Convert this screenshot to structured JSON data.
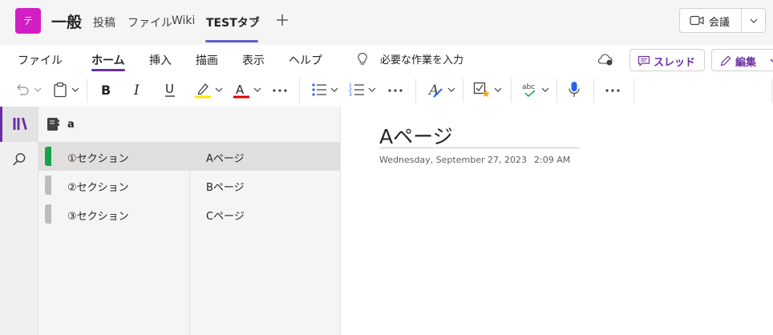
{
  "header": {
    "team_initial": "テ",
    "channel": "一般",
    "tabs": [
      "投稿",
      "ファイル",
      "Wiki",
      "TESTタブ"
    ],
    "add_tab": "+",
    "meet_label": "会議"
  },
  "ribbon": {
    "tabs": [
      "ファイル",
      "ホーム",
      "挿入",
      "描画",
      "表示",
      "ヘルプ"
    ],
    "tell_me": "必要な作業を入力",
    "thread_label": "スレッド",
    "edit_label": "編集"
  },
  "notebook": {
    "title": "a"
  },
  "sections": [
    {
      "label": "①セクション",
      "color": "#16a34a"
    },
    {
      "label": "②セクション",
      "color": "#bdbdbd"
    },
    {
      "label": "③セクション",
      "color": "#bdbdbd"
    }
  ],
  "pages": [
    "Aページ",
    "Bページ",
    "Cページ"
  ],
  "page": {
    "title": "Aページ",
    "date": "Wednesday, September 27, 2023",
    "time": "2:09 AM"
  },
  "colors": {
    "accent": "#6b2fa3",
    "team": "#d21fc4",
    "highlight": "#ffe600",
    "font_color": "#e00000"
  }
}
